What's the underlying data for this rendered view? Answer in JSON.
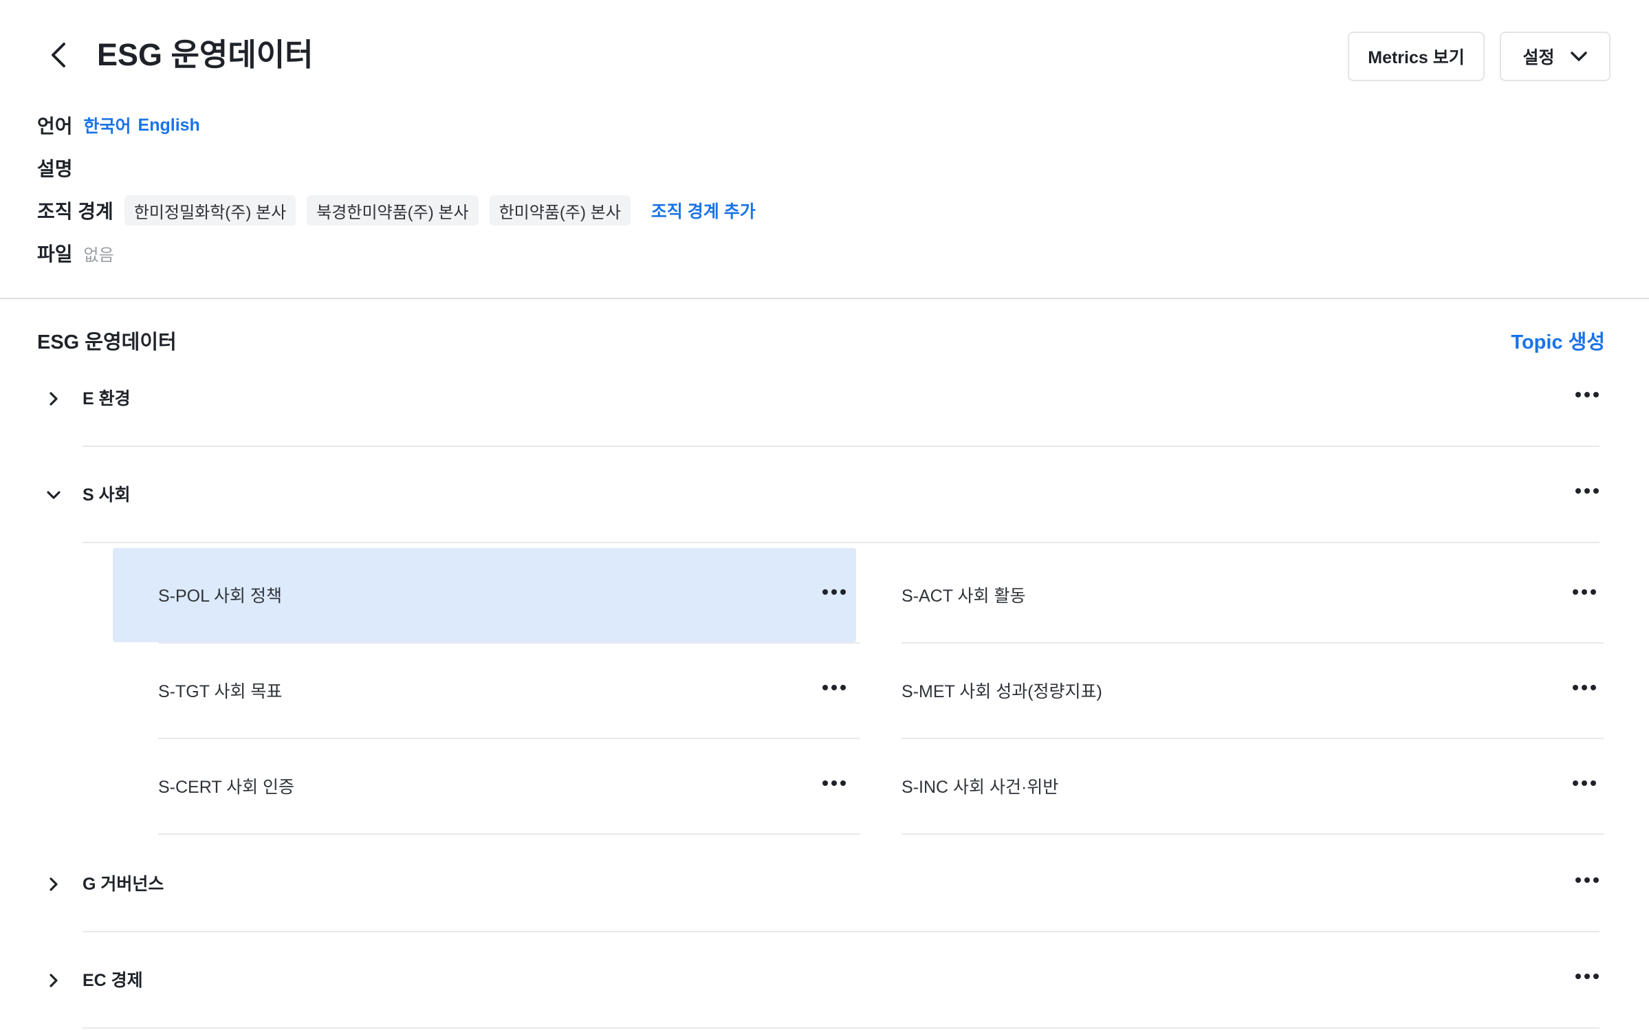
{
  "header": {
    "title": "ESG 운영데이터",
    "metrics_button": "Metrics 보기",
    "settings_button": "설정"
  },
  "meta": {
    "language_label": "언어",
    "languages": [
      "한국어",
      "English"
    ],
    "description_label": "설명",
    "org_label": "조직 경계",
    "orgs": [
      "한미정밀화학(주) 본사",
      "북경한미약품(주) 본사",
      "한미약품(주) 본사"
    ],
    "org_add": "조직 경계 추가",
    "file_label": "파일",
    "file_value": "없음"
  },
  "section": {
    "title": "ESG 운영데이터",
    "topic_create": "Topic 생성"
  },
  "groups": [
    {
      "label": "E 환경",
      "expanded": false
    },
    {
      "label": "S 사회",
      "expanded": true
    },
    {
      "label": "G 거버넌스",
      "expanded": false
    },
    {
      "label": "EC 경제",
      "expanded": false
    }
  ],
  "topics": [
    {
      "label": "S-POL 사회 정책",
      "selected": true
    },
    {
      "label": "S-ACT 사회 활동"
    },
    {
      "label": "S-TGT 사회 목표"
    },
    {
      "label": "S-MET 사회 성과(정량지표)"
    },
    {
      "label": "S-CERT 사회 인증"
    },
    {
      "label": "S-INC 사회 사건·위반"
    }
  ],
  "colors": {
    "accent": "#1a73e8",
    "selected_bg": "#dceafb"
  }
}
